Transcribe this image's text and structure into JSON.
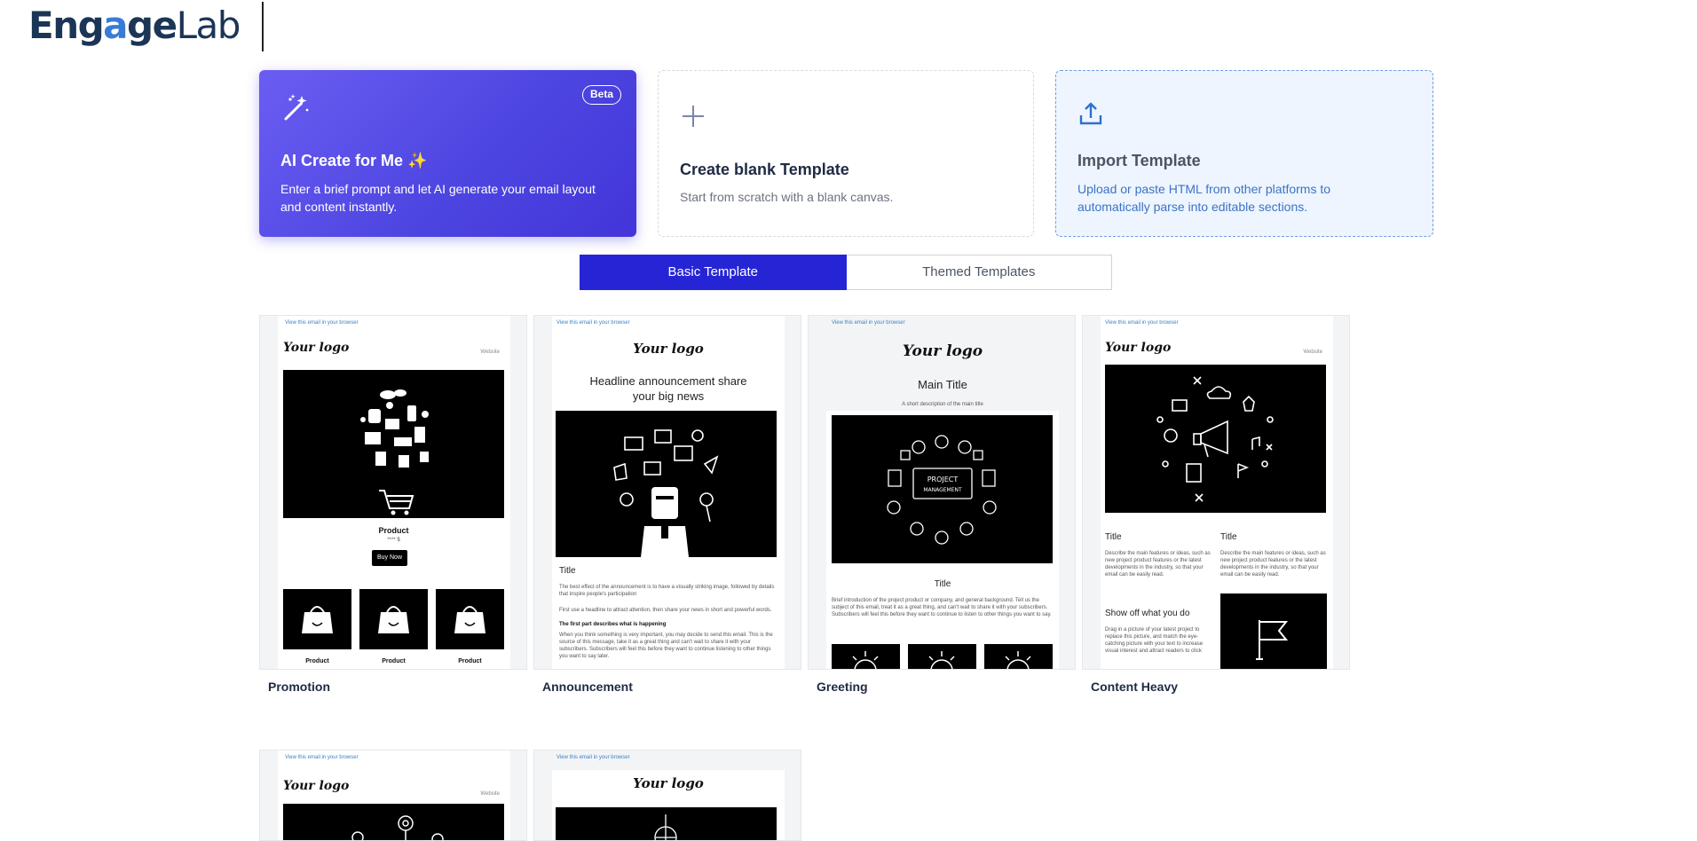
{
  "header": {
    "logo_left": "Eng",
    "logo_a": "a",
    "logo_mid": "ge",
    "logo_right": "Lab"
  },
  "cards": {
    "ai": {
      "badge": "Beta",
      "title": "AI Create for Me",
      "sparkle": "✨",
      "description": "Enter a brief prompt and let AI generate your email layout and content instantly."
    },
    "blank": {
      "title": "Create blank Template",
      "description": "Start from scratch with a blank canvas."
    },
    "import": {
      "title": "Import Template",
      "description": "Upload or paste HTML from other platforms to automatically parse into editable sections."
    }
  },
  "tabs": [
    {
      "label": "Basic Template",
      "active": true
    },
    {
      "label": "Themed Templates",
      "active": false
    }
  ],
  "templates": [
    {
      "name": "Promotion"
    },
    {
      "name": "Announcement"
    },
    {
      "name": "Greeting"
    },
    {
      "name": "Content Heavy"
    },
    {
      "name": ""
    },
    {
      "name": ""
    }
  ],
  "preview": {
    "view_link": "View this email in your browser",
    "your_logo": "Your logo",
    "website": "Website",
    "product": "Product",
    "price": "**** $",
    "buy_now": "Buy Now",
    "headline": "Headline announcement share your big news",
    "title": "Title",
    "main_title": "Main Title",
    "main_desc": "A short description of the main title",
    "pm_label": "PROJECT MANAGEMENT",
    "show_off": "Show off what you do",
    "ann_text1": "The best effect of the announcement is to have a visually striking image, followed by details that inspire people's participation",
    "ann_text2": "First use a headline to attract attention, then share your news in short and powerful words.",
    "ann_bold": "The first part describes what is happening",
    "ann_text3": "When you think something is very important, you may decide to send this email. This is the source of this message, take it as a great thing and can't wait to share it with your subscribers. Subscribers will feel this before they want to continue listening to other things you want to say later.",
    "greet_text": "Brief introduction of the project product or company, and general background. Tell us the subject of this email, treat it as a great thing, and can't wait to share it with your subscribers. Subscribers will feel this before they want to continue to listen to other things you want to say.",
    "heavy_text": "Describe the main features or ideas, such as new project product features or the latest developments in the industry, so that your email can be easily read.",
    "heavy_text2": "Drag in a picture of your latest project to replace this picture, and match the eye-catching picture with your text to increase visual interest and attract readers to click"
  },
  "colors": {
    "accent": "#2625d6",
    "ai_gradient_start": "#6a5df2",
    "ai_gradient_end": "#4335d9",
    "import_bg": "#eef5fe",
    "import_text": "#3b73c6"
  }
}
